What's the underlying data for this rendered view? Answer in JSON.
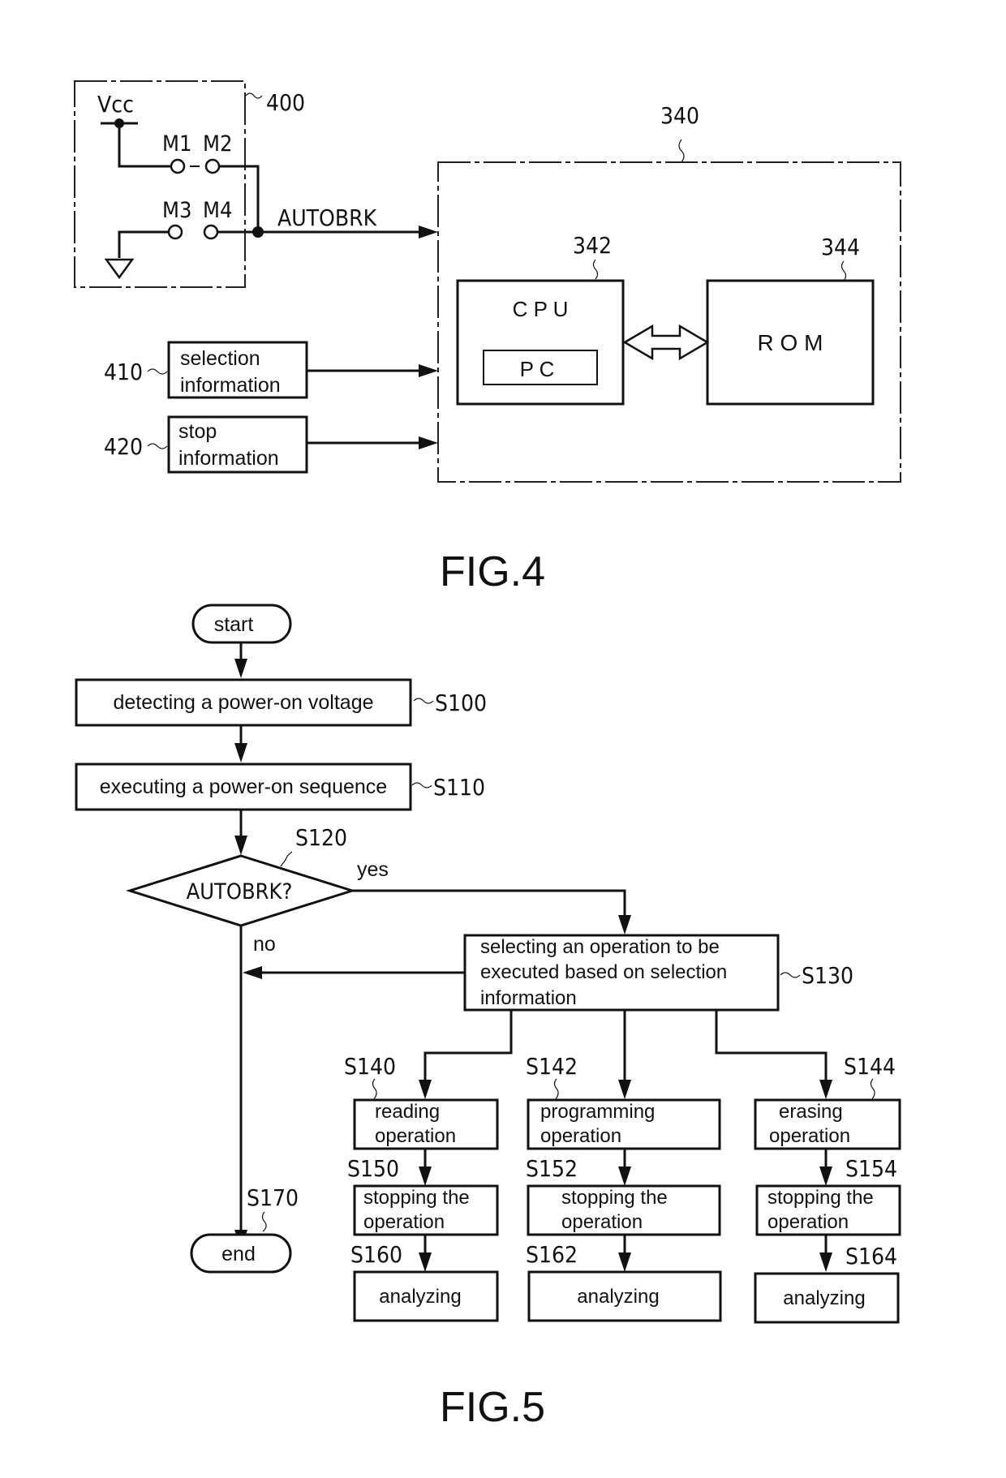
{
  "fig4": {
    "caption": "FIG.4",
    "switch_block": {
      "ref": "400",
      "vcc": "Vcc",
      "m1": "M1",
      "m2": "M2",
      "m3": "M3",
      "m4": "M4"
    },
    "signal_label": "AUTOBRK",
    "controller": {
      "ref": "340"
    },
    "cpu": {
      "ref": "342",
      "label": "C P U",
      "pc_label": "P C"
    },
    "rom": {
      "ref": "344",
      "label": "R O M"
    },
    "selection_info": {
      "ref": "410",
      "line1": "selection",
      "line2": "information"
    },
    "stop_info": {
      "ref": "420",
      "line1": "stop",
      "line2": "information"
    }
  },
  "fig5": {
    "caption": "FIG.5",
    "start": "start",
    "end": "end",
    "end_ref": "S170",
    "s100": {
      "ref": "S100",
      "label": "detecting a power-on voltage"
    },
    "s110": {
      "ref": "S110",
      "label": "executing a power-on sequence"
    },
    "s120": {
      "ref": "S120",
      "label": "AUTOBRK?",
      "yes": "yes",
      "no": "no"
    },
    "s130": {
      "ref": "S130",
      "line1": "selecting an operation to be",
      "line2": "executed based on selection",
      "line3": "information"
    },
    "branches": [
      {
        "op_ref": "S140",
        "op1": "reading",
        "op2": "operation",
        "stop_ref": "S150",
        "stop1": "stopping the",
        "stop2": "operation",
        "an_ref": "S160",
        "an": "analyzing"
      },
      {
        "op_ref": "S142",
        "op1": "programming",
        "op2": "operation",
        "stop_ref": "S152",
        "stop1": "stopping the",
        "stop2": "operation",
        "an_ref": "S162",
        "an": "analyzing"
      },
      {
        "op_ref": "S144",
        "op1": "erasing",
        "op2": "operation",
        "stop_ref": "S154",
        "stop1": "stopping the",
        "stop2": "operation",
        "an_ref": "S164",
        "an": "analyzing"
      }
    ]
  }
}
